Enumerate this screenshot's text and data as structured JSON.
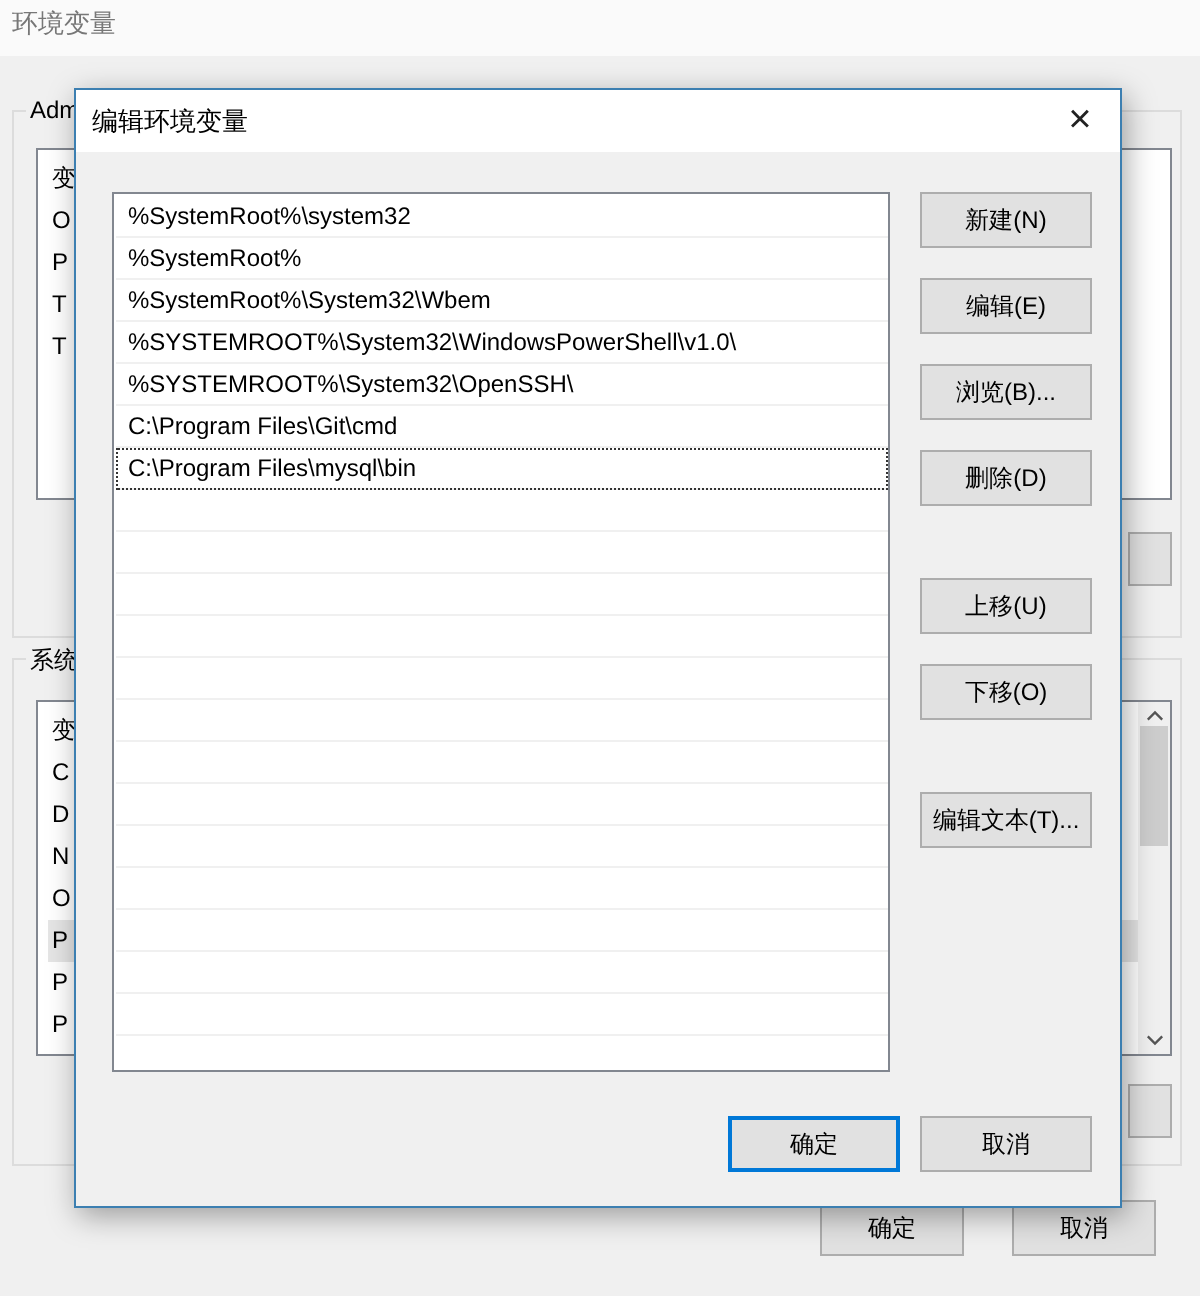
{
  "background_window": {
    "title": "环境变量",
    "user_group": {
      "label": "Adm",
      "items": [
        {
          "text": "变",
          "selected": false
        },
        {
          "text": "O",
          "selected": false
        },
        {
          "text": "P",
          "selected": false
        },
        {
          "text": "T",
          "selected": false
        },
        {
          "text": "T",
          "selected": false
        }
      ]
    },
    "system_group": {
      "label": "系统",
      "items": [
        {
          "text": "变",
          "selected": false
        },
        {
          "text": "C",
          "selected": false
        },
        {
          "text": "D",
          "selected": false
        },
        {
          "text": "N",
          "selected": false
        },
        {
          "text": "O",
          "selected": false
        },
        {
          "text": "P",
          "selected": true
        },
        {
          "text": "P",
          "selected": false
        },
        {
          "text": "P",
          "selected": false
        }
      ]
    },
    "buttons": [
      {
        "label": "确定",
        "default": false
      },
      {
        "label": "取消",
        "default": false
      }
    ]
  },
  "dialog": {
    "title": "编辑环境变量",
    "close": "×",
    "paths": [
      {
        "text": "%SystemRoot%\\system32",
        "selected": false
      },
      {
        "text": "%SystemRoot%",
        "selected": false
      },
      {
        "text": "%SystemRoot%\\System32\\Wbem",
        "selected": false
      },
      {
        "text": "%SYSTEMROOT%\\System32\\WindowsPowerShell\\v1.0\\",
        "selected": false
      },
      {
        "text": "%SYSTEMROOT%\\System32\\OpenSSH\\",
        "selected": false
      },
      {
        "text": "C:\\Program Files\\Git\\cmd",
        "selected": false
      },
      {
        "text": "C:\\Program Files\\mysql\\bin",
        "selected": true
      }
    ],
    "side_button_groups": [
      [
        "新建(N)",
        "编辑(E)",
        "浏览(B)...",
        "删除(D)"
      ],
      [
        "上移(U)",
        "下移(O)"
      ],
      [
        "编辑文本(T)..."
      ]
    ],
    "buttons": [
      {
        "label": "确定",
        "default": true
      },
      {
        "label": "取消",
        "default": false
      }
    ]
  }
}
